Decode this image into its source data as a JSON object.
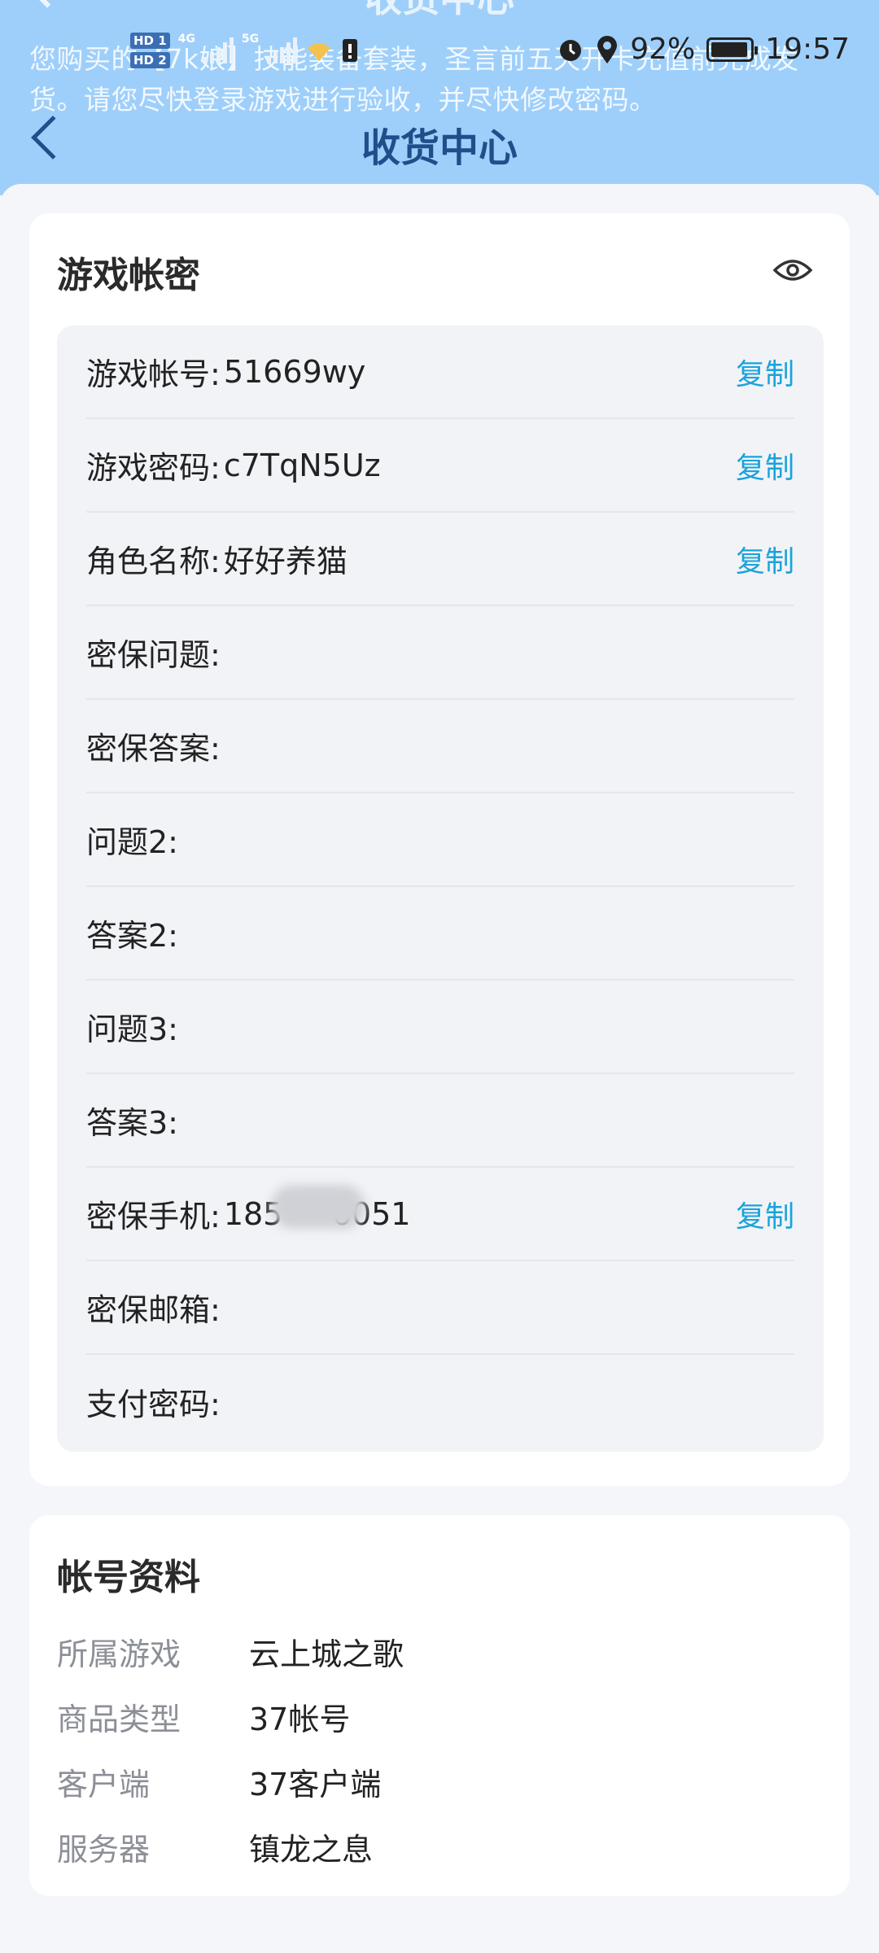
{
  "status_bar": {
    "hd1": "HD 1",
    "hd2": "HD 2",
    "net1": "4G",
    "net2": "5G",
    "battery": "92%",
    "time": "19:57"
  },
  "banner": "您购买的【7k娘】技能装备套装，圣言前五天开卡充值前完成发货。请您尽快登录游戏进行验收，并尽快修改密码。",
  "header": {
    "title": "收货中心"
  },
  "account_card": {
    "title": "游戏帐密",
    "copy_label": "复制",
    "rows": [
      {
        "label": "游戏帐号:",
        "value": "51669wy",
        "copy": true
      },
      {
        "label": "游戏密码:",
        "value": "c7TqN5Uz",
        "copy": true
      },
      {
        "label": "角色名称:",
        "value": "好好养猫",
        "copy": true
      },
      {
        "label": "密保问题:",
        "value": "",
        "copy": false
      },
      {
        "label": "密保答案:",
        "value": "",
        "copy": false
      },
      {
        "label": "问题2:",
        "value": "",
        "copy": false
      },
      {
        "label": "答案2:",
        "value": "",
        "copy": false
      },
      {
        "label": "问题3:",
        "value": "",
        "copy": false
      },
      {
        "label": "答案3:",
        "value": "",
        "copy": false
      },
      {
        "label": "密保手机:",
        "value": "185     6051",
        "copy": true
      },
      {
        "label": "密保邮箱:",
        "value": "",
        "copy": false
      },
      {
        "label": "支付密码:",
        "value": "",
        "copy": false
      }
    ]
  },
  "profile_card": {
    "title": "帐号资料",
    "items": [
      {
        "key": "所属游戏",
        "value": "云上城之歌"
      },
      {
        "key": "商品类型",
        "value": "37帐号"
      },
      {
        "key": "客户端",
        "value": "37客户端"
      },
      {
        "key": "服务器",
        "value": "镇龙之息"
      }
    ]
  }
}
